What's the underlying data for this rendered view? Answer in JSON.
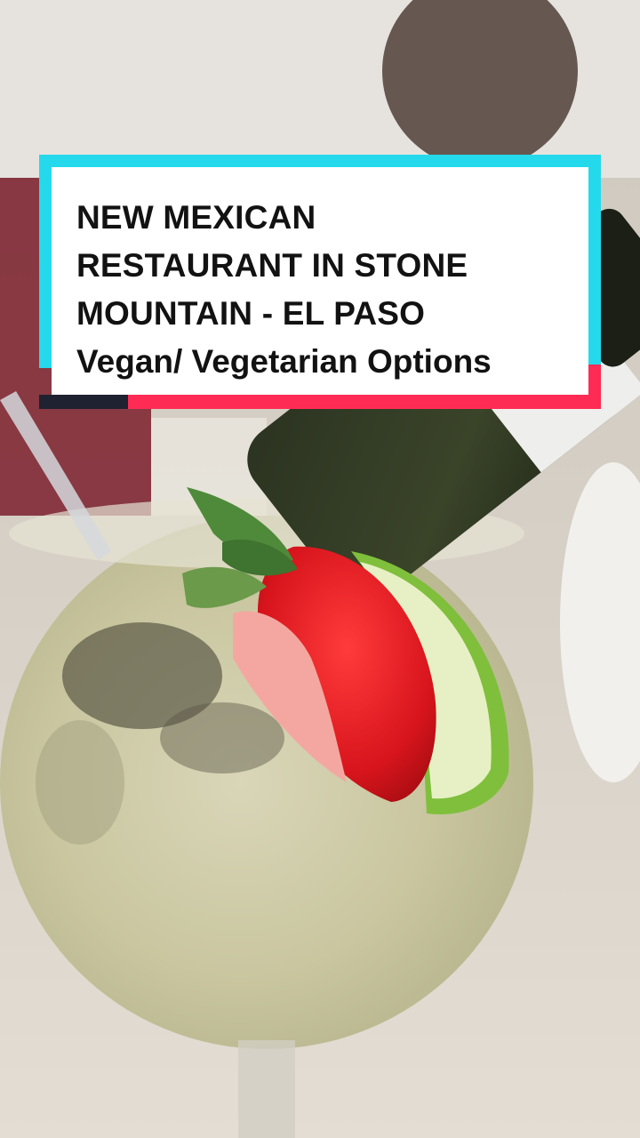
{
  "caption": {
    "title_lines": [
      "NEW MEXICAN",
      "RESTAURANT IN STONE",
      "MOUNTAIN - EL PASO"
    ],
    "subtitle": "Vegan/ Vegetarian Options"
  },
  "colors": {
    "accent_cyan": "#25d9ec",
    "accent_red": "#fe2c55",
    "card_background": "#ffffff",
    "text": "#121212"
  }
}
